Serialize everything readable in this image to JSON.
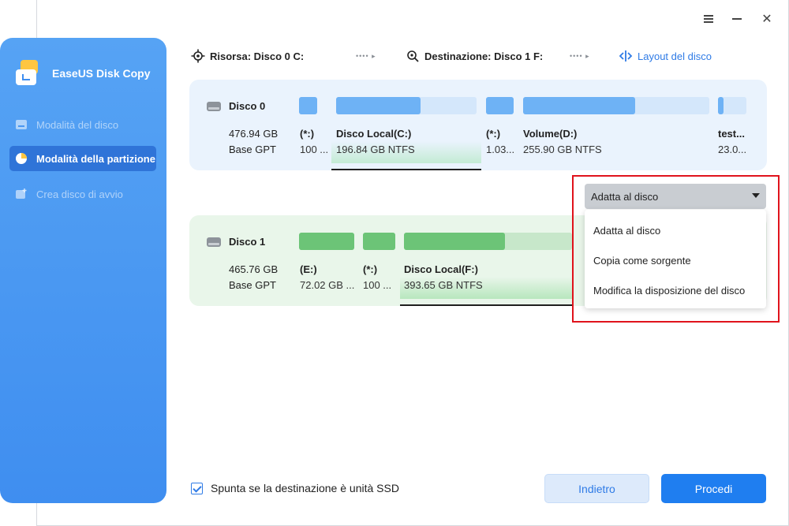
{
  "app": {
    "title": "EaseUS Disk Copy"
  },
  "window": {
    "menu_icon": "hamburger-icon",
    "min_icon": "minimize-icon",
    "close_icon": "close-icon",
    "close_glyph": "✕"
  },
  "sidebar": {
    "items": [
      {
        "label": "Modalità del disco",
        "icon": "disk-icon",
        "active": false
      },
      {
        "label": "Modalità della partizione",
        "icon": "pie-chart-icon",
        "active": true
      },
      {
        "label": "Crea disco di avvio",
        "icon": "boot-disk-icon",
        "active": false
      }
    ]
  },
  "header": {
    "source": "Risorsa: Disco 0 C:",
    "destination": "Destinazione: Disco 1 F:",
    "separator": "•••• ▸",
    "layout_link": "Layout del disco"
  },
  "disks": [
    {
      "name": "Disco 0",
      "size": "476.94 GB",
      "type": "Base GPT",
      "partitions": [
        {
          "label": "(*:)",
          "sub": "100 ...",
          "used": 1.0
        },
        {
          "label": "Disco Local(C:)",
          "sub": "196.84 GB NTFS",
          "used": 0.6,
          "selected": true
        },
        {
          "label": "(*:)",
          "sub": "1.03...",
          "used": 1.0
        },
        {
          "label": "Volume(D:)",
          "sub": "255.90 GB NTFS",
          "used": 0.6
        },
        {
          "label": "test...",
          "sub": "23.0...",
          "used": 0.2
        }
      ]
    },
    {
      "name": "Disco 1",
      "size": "465.76 GB",
      "type": "Base GPT",
      "partitions": [
        {
          "label": "(E:)",
          "sub": "72.02 GB ...",
          "used": 1.0
        },
        {
          "label": "(*:)",
          "sub": "100 ...",
          "used": 1.0
        },
        {
          "label": "Disco Local(F:)",
          "sub": "393.65 GB NTFS",
          "used": 0.6,
          "selected": true
        }
      ]
    }
  ],
  "dropdown": {
    "selected": "Adatta al disco",
    "options": [
      "Adatta al disco",
      "Copia come sorgente",
      "Modifica la disposizione del disco"
    ]
  },
  "footer": {
    "ssd_checkbox_label": "Spunta se la destinazione è unità SSD",
    "ssd_checked": true,
    "back_label": "Indietro",
    "next_label": "Procedi"
  },
  "colors": {
    "accent": "#1f7ef0",
    "disk0_used": "#6eb2f5",
    "disk0_free": "#d4e7fb",
    "disk1_used": "#6cc477",
    "disk1_free": "#c7e7ca",
    "highlight": "#e0131c"
  }
}
